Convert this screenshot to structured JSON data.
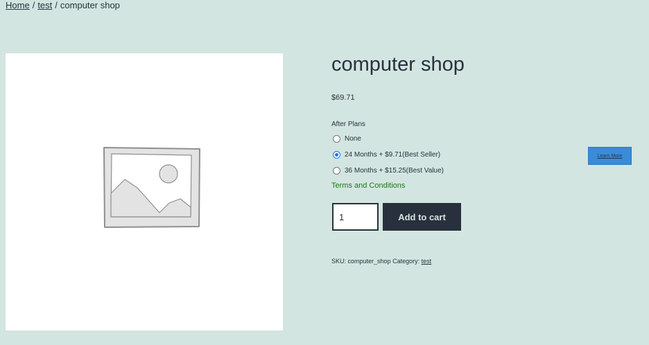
{
  "breadcrumb": {
    "home": "Home",
    "separator": "/",
    "category": "test",
    "current": "computer shop"
  },
  "product": {
    "title": "computer shop",
    "price": "$69.71",
    "image_icon": "placeholder-image-icon"
  },
  "plans": {
    "heading": "After Plans",
    "options": [
      {
        "label": "None",
        "selected": false
      },
      {
        "label": "24 Months + $9.71(Best Seller)",
        "selected": true
      },
      {
        "label": "36 Months + $15.25(Best Value)",
        "selected": false
      }
    ],
    "terms_link": "Terms and Conditions",
    "learn_more": "Learn More"
  },
  "cart": {
    "quantity": "1",
    "button_label": "Add to cart"
  },
  "meta": {
    "sku_label": "SKU:",
    "sku_value": "computer_shop",
    "category_label": "Category:",
    "category_value": "test"
  },
  "colors": {
    "background": "#d3e5e0",
    "text": "#28303d",
    "radio_accent": "#1a73e8",
    "terms_link": "#1b7a1b",
    "learn_more_bg": "#3a8bd8"
  }
}
